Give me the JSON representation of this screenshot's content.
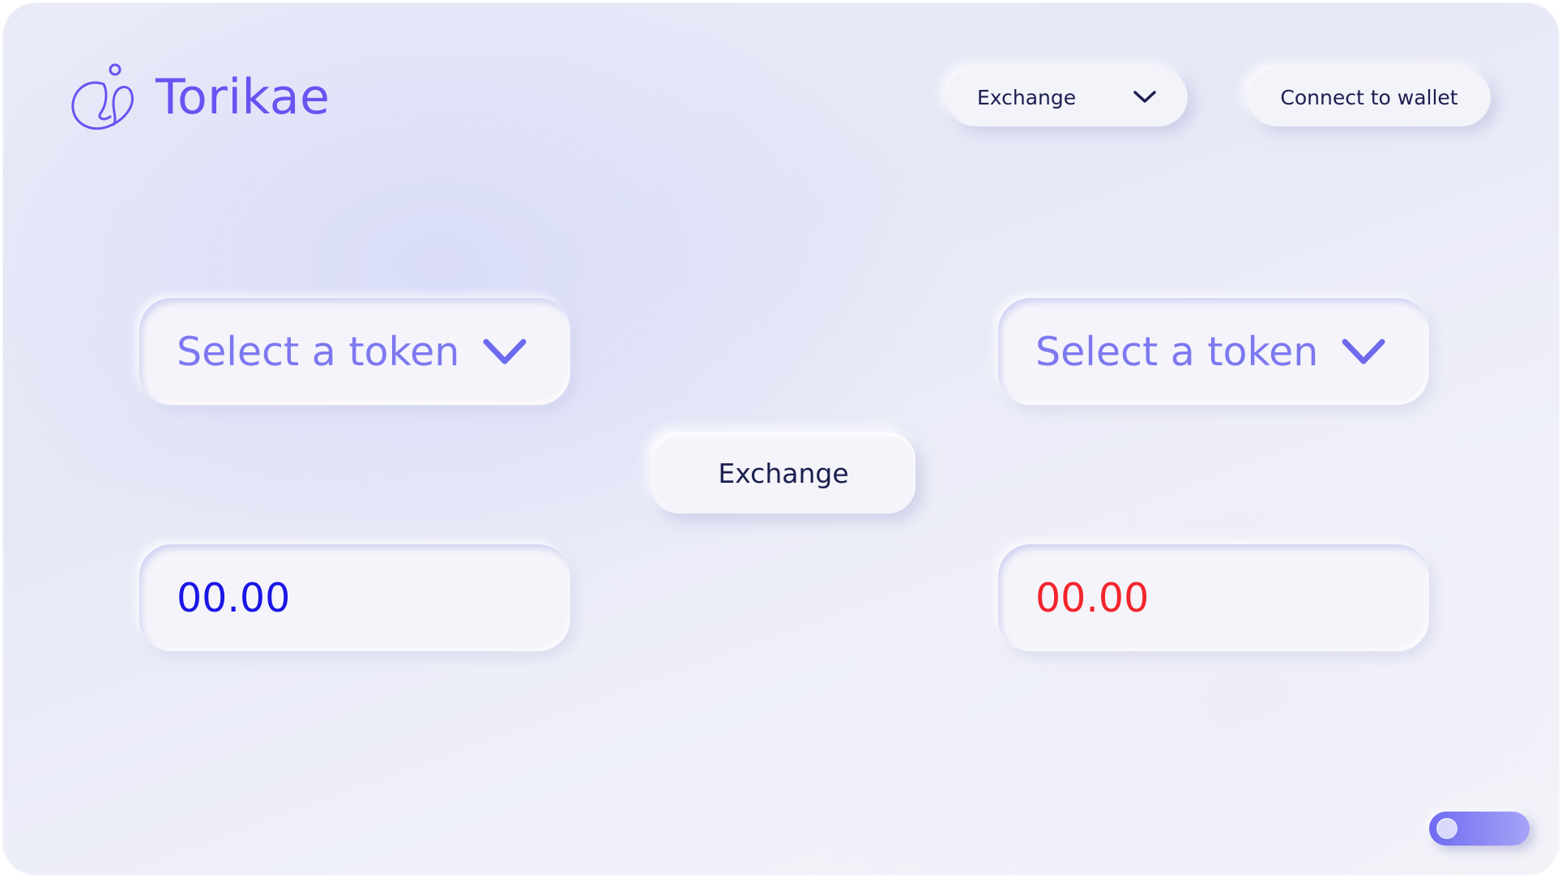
{
  "app": {
    "brand": "Torikae",
    "brand_color": "#6a52f2"
  },
  "header": {
    "nav_dropdown": {
      "selected": "Exchange",
      "icon": "chevron-down-icon"
    },
    "connect_wallet_label": "Connect to wallet"
  },
  "exchange": {
    "from": {
      "token_placeholder": "Select a token",
      "amount": "00.00",
      "amount_color": "#1a16e6"
    },
    "to": {
      "token_placeholder": "Select a token",
      "amount": "00.00",
      "amount_color": "#f2262c"
    },
    "button_label": "Exchange"
  },
  "theme_toggle": {
    "state": "off",
    "accent": "#6f6cf2"
  }
}
